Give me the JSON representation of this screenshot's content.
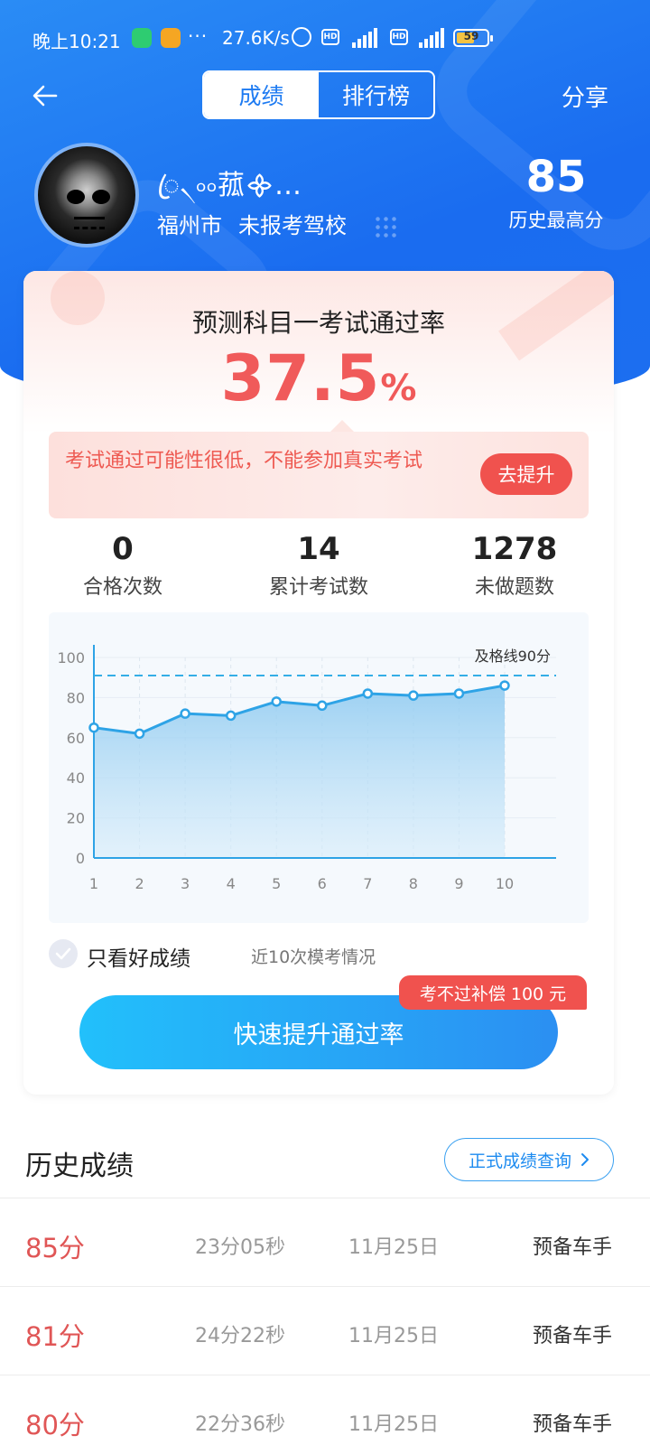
{
  "status_bar": {
    "time": "晚上10:21",
    "dots": "···",
    "speed": "27.6K/s",
    "hd_label": "HD",
    "battery": "59",
    "battery_level": 0.59
  },
  "nav": {
    "tabs": [
      {
        "label": "成绩",
        "active": true
      },
      {
        "label": "排行榜",
        "active": false
      }
    ],
    "share_label": "分享"
  },
  "profile": {
    "username": "ꦿ৲৹৹菰᯽…",
    "city": "福州市",
    "school": "未报考驾校",
    "best_score": "85",
    "best_label": "历史最高分"
  },
  "prediction": {
    "title": "预测科目一考试通过率",
    "rate_value": "37.5",
    "rate_unit": "%",
    "warning": "考试通过可能性很低，不能参加真实考试",
    "improve_label": "去提升"
  },
  "stats": [
    {
      "value": "0",
      "label": "合格次数"
    },
    {
      "value": "14",
      "label": "累计考试数"
    },
    {
      "value": "1278",
      "label": "未做题数"
    }
  ],
  "chart_data": {
    "type": "area",
    "x": [
      1,
      2,
      3,
      4,
      5,
      6,
      7,
      8,
      9,
      10
    ],
    "series": [
      {
        "values": [
          65,
          62,
          72,
          71,
          78,
          76,
          82,
          81,
          82,
          86
        ]
      }
    ],
    "ylim": [
      0,
      100
    ],
    "yticks": [
      0,
      20,
      40,
      60,
      80,
      100
    ],
    "reference_line": {
      "value": 91,
      "label": "及格线90分"
    },
    "grid": true,
    "color": "#2ea3e6"
  },
  "filter": {
    "label": "只看好成绩",
    "hint": "近10次模考情况"
  },
  "promo": {
    "tag": "考不过补偿 100 元",
    "cta": "快速提升通过率"
  },
  "history": {
    "title": "历史成绩",
    "query_label": "正式成绩查询",
    "rows": [
      {
        "score": "85分",
        "duration": "23分05秒",
        "date": "11月25日",
        "level": "预备车手"
      },
      {
        "score": "81分",
        "duration": "24分22秒",
        "date": "11月25日",
        "level": "预备车手"
      },
      {
        "score": "80分",
        "duration": "22分36秒",
        "date": "11月25日",
        "level": "预备车手"
      }
    ]
  },
  "colors": {
    "brand_blue": "#1e7bf2",
    "danger_red": "#f05a5a"
  }
}
